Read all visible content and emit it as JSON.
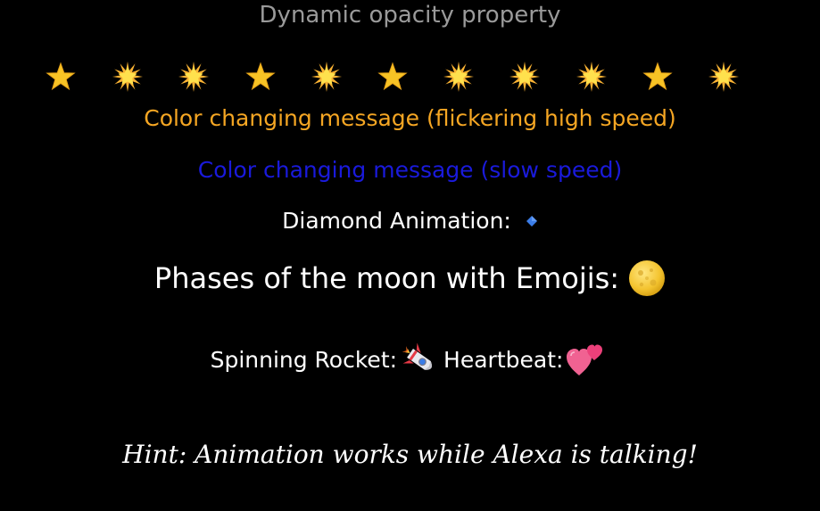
{
  "opacity": {
    "text": "Dynamic opacity property"
  },
  "stars": {
    "icons": [
      "star-icon",
      "glowing-star-icon",
      "glowing-star-icon",
      "star-icon",
      "glowing-star-icon",
      "star-icon",
      "glowing-star-icon",
      "glowing-star-icon",
      "glowing-star-icon",
      "star-icon",
      "glowing-star-icon"
    ]
  },
  "messages": {
    "fast": "Color changing message (flickering high speed)",
    "fast_color": "#f5a623",
    "slow": "Color changing message (slow speed)",
    "slow_color": "#1a1adb"
  },
  "diamond": {
    "label": "Diamond Animation:",
    "icon": "small-blue-diamond-icon",
    "color": "#3b7de8"
  },
  "moon": {
    "label": "Phases of the moon with Emojis:",
    "icon": "full-moon-icon"
  },
  "rocket": {
    "label": "Spinning Rocket:",
    "icon": "rocket-icon"
  },
  "heartbeat": {
    "label": "Heartbeat:",
    "icon": "two-hearts-icon"
  },
  "hint": {
    "text": "Hint: Animation works while Alexa is talking!"
  }
}
